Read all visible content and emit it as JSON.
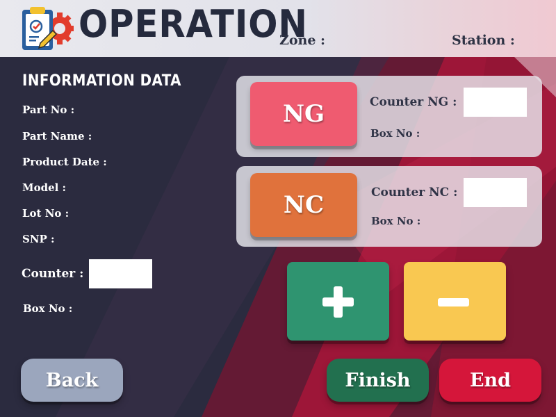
{
  "header": {
    "title": "OPERATION",
    "zone_label": "Zone :",
    "station_label": "Station :"
  },
  "info": {
    "title": "INFORMATION DATA",
    "fields": [
      "Part No :",
      "Part Name :",
      "Product Date :",
      "Model :",
      "Lot No :",
      "SNP :"
    ],
    "counter_label": "Counter :",
    "box_no_label": "Box No :"
  },
  "ng_panel": {
    "button_label": "NG",
    "counter_label": "Counter NG :",
    "box_no_label": "Box No :"
  },
  "nc_panel": {
    "button_label": "NC",
    "counter_label": "Counter NC :",
    "box_no_label": "Box No :"
  },
  "buttons": {
    "back": "Back",
    "finish": "Finish",
    "end": "End"
  },
  "icons": {
    "plus": "plus-icon",
    "minus": "minus-icon",
    "logo": "clipboard-gear-icon"
  },
  "colors": {
    "ng": "#ef5b70",
    "nc": "#e0723c",
    "plus": "#2f9470",
    "minus": "#f9c851",
    "back": "#9ba6bd",
    "finish": "#22704f",
    "end": "#d5163a"
  }
}
